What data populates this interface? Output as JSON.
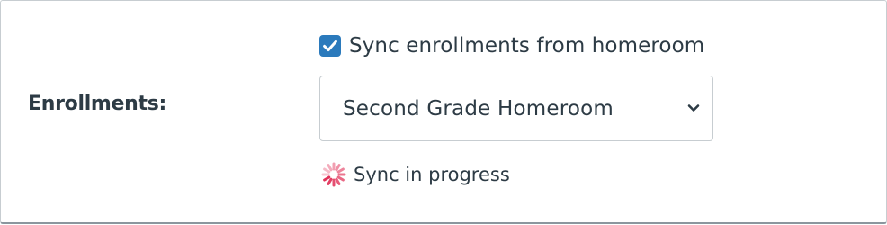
{
  "enrollments": {
    "label": "Enrollments:",
    "sync_checkbox": {
      "label": "Sync enrollments from homeroom",
      "checked": true,
      "color": "#2b7abc"
    },
    "homeroom_select": {
      "selected": "Second Grade Homeroom",
      "icon": "chevron-down-icon"
    },
    "sync_status": {
      "text": "Sync in progress",
      "icon": "loading-spinner-icon",
      "color": "#e0264f"
    }
  }
}
